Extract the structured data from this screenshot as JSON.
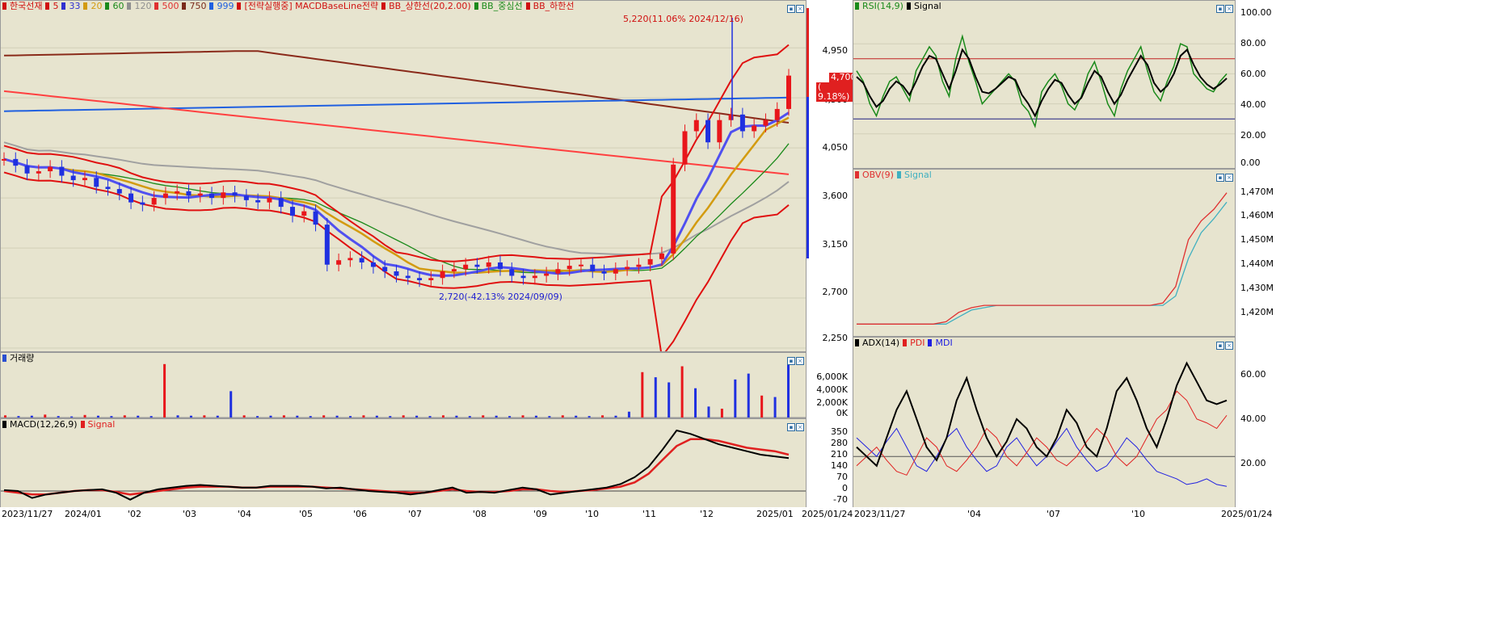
{
  "colors": {
    "up": "#e8161b",
    "down": "#1f30e0",
    "bg": "#e7e4cf"
  },
  "main_legend": [
    {
      "text": "한국선재",
      "color": "#d01010"
    },
    {
      "text": "5",
      "color": "#d01010"
    },
    {
      "text": "33",
      "color": "#3030d0"
    },
    {
      "text": "20",
      "color": "#d39b10"
    },
    {
      "text": "60",
      "color": "#1a8a1a"
    },
    {
      "text": "120",
      "color": "#909090"
    },
    {
      "text": "500",
      "color": "#e03030"
    },
    {
      "text": "750",
      "color": "#7a2a1a"
    },
    {
      "text": "999",
      "color": "#2060e0"
    },
    {
      "text": "[전략실행중] MACDBaseLine전략",
      "color": "#d01010"
    },
    {
      "text": "BB_상한선(20,2.00)",
      "color": "#d01010"
    },
    {
      "text": "BB_중심선",
      "color": "#1a8a1a"
    },
    {
      "text": "BB_하한선",
      "color": "#d01010"
    }
  ],
  "vol_legend": "거래량",
  "macd_legend": [
    {
      "text": "MACD(12,26,9)",
      "color": "#000000"
    },
    {
      "text": "Signal",
      "color": "#e02020"
    }
  ],
  "rsi_legend": [
    {
      "text": "RSI(14,9)",
      "color": "#1a8a1a"
    },
    {
      "text": "Signal",
      "color": "#000000"
    }
  ],
  "obv_legend": [
    {
      "text": "OBV(9)",
      "color": "#e03030"
    },
    {
      "text": "Signal",
      "color": "#40b0c0"
    }
  ],
  "adx_legend": [
    {
      "text": "ADX(14)",
      "color": "#000000"
    },
    {
      "text": "PDI",
      "color": "#e02020"
    },
    {
      "text": "MDI",
      "color": "#2020e0"
    }
  ],
  "annotations": {
    "high": "5,220(11.06% 2024/12/16)",
    "low": "2,720(-42.13% 2024/09/09)"
  },
  "current_price": {
    "price": "4,700",
    "change": "( 9.18%)"
  },
  "price_axis": [
    "4,950",
    "4,500",
    "4,050",
    "3,600",
    "3,150",
    "2,700",
    "2,250"
  ],
  "volume_axis": [
    "6,000K",
    "4,000K",
    "2,000K",
    "0K"
  ],
  "macd_axis": [
    "350",
    "280",
    "210",
    "140",
    "70",
    "0",
    "-70"
  ],
  "rsi_axis": [
    "100.00",
    "80.00",
    "60.00",
    "40.00",
    "20.00",
    "0.00"
  ],
  "obv_axis": [
    "1,470M",
    "1,460M",
    "1,450M",
    "1,440M",
    "1,430M",
    "1,420M"
  ],
  "adx_axis": [
    "60.00",
    "40.00",
    "20.00"
  ],
  "x_main": [
    "2023/11/27",
    "2024/01",
    "'02",
    "'03",
    "'04",
    "'05",
    "'06",
    "'07",
    "'08",
    "'09",
    "'10",
    "'11",
    "'12",
    "2025/01",
    "2025/01/24"
  ],
  "x_right": [
    "2023/11/27",
    "'04",
    "'07",
    "'10",
    "2025/01/24"
  ],
  "chart_data": {
    "type": "candlestick",
    "symbol": "한국선재",
    "period": [
      "2023/11/27",
      "2025/01/24"
    ],
    "high": {
      "value": 5220,
      "change_pct": 11.06,
      "date": "2024/12/16"
    },
    "low": {
      "value": 2720,
      "change_pct": -42.13,
      "date": "2024/09/09"
    },
    "close": {
      "value": 4700,
      "change_pct": 9.18
    },
    "price_range": [
      2250,
      5300
    ],
    "close_series": [
      3950,
      3890,
      3820,
      3840,
      3880,
      3800,
      3760,
      3780,
      3700,
      3680,
      3640,
      3560,
      3540,
      3600,
      3640,
      3660,
      3620,
      3640,
      3600,
      3650,
      3620,
      3580,
      3560,
      3600,
      3520,
      3440,
      3480,
      3360,
      3000,
      3040,
      3060,
      3020,
      2980,
      2940,
      2900,
      2880,
      2860,
      2880,
      2940,
      2960,
      3000,
      2980,
      3020,
      2960,
      2900,
      2880,
      2900,
      2920,
      2960,
      2990,
      3000,
      2940,
      2920,
      2960,
      2980,
      3000,
      3050,
      3100,
      3900,
      4200,
      4300,
      4100,
      4300,
      4350,
      4200,
      4250,
      4300,
      4400,
      4700
    ],
    "volume_series_k": [
      300,
      200,
      250,
      400,
      200,
      150,
      350,
      250,
      200,
      300,
      250,
      200,
      7300,
      300,
      250,
      300,
      250,
      3600,
      300,
      200,
      250,
      300,
      250,
      200,
      300,
      250,
      200,
      300,
      250,
      200,
      300,
      250,
      200,
      300,
      250,
      200,
      300,
      250,
      200,
      300,
      250,
      200,
      300,
      250,
      200,
      300,
      250,
      800,
      6200,
      5500,
      4800,
      7000,
      4000,
      1500,
      1200,
      5200,
      6000,
      3000,
      2800,
      7200
    ],
    "macd": [
      5,
      0,
      -40,
      -20,
      -10,
      0,
      5,
      10,
      -10,
      -50,
      -10,
      10,
      20,
      30,
      35,
      30,
      25,
      20,
      20,
      30,
      30,
      30,
      25,
      15,
      20,
      10,
      0,
      -5,
      -10,
      -20,
      -10,
      5,
      20,
      -10,
      -5,
      -10,
      5,
      20,
      10,
      -20,
      -10,
      0,
      10,
      20,
      40,
      80,
      140,
      240,
      350,
      330,
      300,
      270,
      250,
      230,
      210,
      200,
      190
    ],
    "macd_signal": [
      0,
      -10,
      -20,
      -20,
      -10,
      0,
      5,
      5,
      -5,
      -20,
      -10,
      0,
      10,
      20,
      25,
      25,
      25,
      20,
      20,
      25,
      25,
      25,
      25,
      20,
      15,
      10,
      5,
      0,
      -5,
      -10,
      -10,
      0,
      10,
      0,
      -5,
      -5,
      0,
      10,
      10,
      0,
      -5,
      0,
      5,
      15,
      25,
      50,
      100,
      180,
      260,
      300,
      300,
      290,
      270,
      250,
      240,
      230,
      210
    ],
    "rsi": [
      62,
      55,
      40,
      32,
      45,
      55,
      58,
      50,
      42,
      62,
      70,
      78,
      72,
      55,
      45,
      70,
      85,
      68,
      55,
      40,
      45,
      50,
      55,
      60,
      55,
      40,
      35,
      25,
      48,
      55,
      60,
      52,
      40,
      36,
      45,
      60,
      68,
      55,
      40,
      32,
      50,
      62,
      70,
      78,
      62,
      48,
      42,
      55,
      65,
      80,
      78,
      60,
      55,
      50,
      48,
      55,
      60
    ],
    "rsi_signal": [
      58,
      54,
      45,
      38,
      42,
      50,
      55,
      52,
      46,
      55,
      65,
      72,
      70,
      60,
      50,
      62,
      76,
      70,
      58,
      48,
      47,
      50,
      54,
      58,
      56,
      46,
      40,
      32,
      42,
      50,
      56,
      54,
      46,
      40,
      44,
      54,
      62,
      58,
      48,
      40,
      46,
      56,
      64,
      72,
      66,
      54,
      48,
      52,
      60,
      72,
      76,
      66,
      58,
      53,
      50,
      53,
      57
    ],
    "obv_m": [
      1416,
      1416,
      1416,
      1416,
      1416,
      1416,
      1416,
      1417,
      1421,
      1423,
      1424,
      1424,
      1424,
      1424,
      1424,
      1424,
      1424,
      1424,
      1424,
      1424,
      1424,
      1424,
      1424,
      1424,
      1425,
      1432,
      1452,
      1460,
      1465,
      1472
    ],
    "obv_signal_m": [
      1416,
      1416,
      1416,
      1416,
      1416,
      1416,
      1416,
      1416,
      1419,
      1422,
      1423,
      1424,
      1424,
      1424,
      1424,
      1424,
      1424,
      1424,
      1424,
      1424,
      1424,
      1424,
      1424,
      1424,
      1424,
      1428,
      1444,
      1455,
      1461,
      1468
    ],
    "adx": [
      25,
      20,
      15,
      30,
      45,
      55,
      40,
      25,
      18,
      30,
      50,
      62,
      45,
      30,
      20,
      28,
      40,
      35,
      25,
      20,
      30,
      45,
      38,
      25,
      20,
      35,
      55,
      62,
      50,
      35,
      25,
      40,
      58,
      70,
      60,
      50,
      48,
      50
    ],
    "pdi": [
      15,
      20,
      25,
      18,
      12,
      10,
      20,
      30,
      25,
      15,
      12,
      18,
      25,
      35,
      30,
      20,
      15,
      22,
      30,
      25,
      18,
      15,
      20,
      28,
      35,
      30,
      20,
      15,
      20,
      30,
      40,
      45,
      55,
      50,
      40,
      38,
      35,
      42
    ],
    "mdi": [
      30,
      25,
      20,
      28,
      35,
      25,
      15,
      12,
      20,
      30,
      35,
      25,
      18,
      12,
      15,
      25,
      30,
      22,
      15,
      20,
      28,
      35,
      25,
      18,
      12,
      15,
      22,
      30,
      25,
      18,
      12,
      10,
      8,
      5,
      6,
      8,
      5,
      4
    ]
  }
}
